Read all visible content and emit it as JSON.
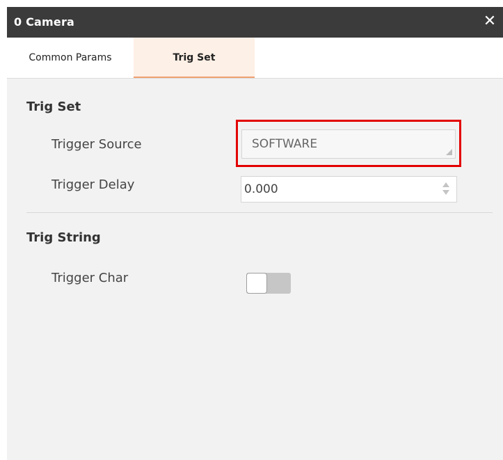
{
  "window": {
    "title": "0 Camera",
    "close_icon": "close-icon",
    "close_glyph": "✕"
  },
  "tabs": [
    {
      "label": "Common Params",
      "active": false
    },
    {
      "label": "Trig Set",
      "active": true
    }
  ],
  "sections": {
    "trig_set": {
      "title": "Trig Set",
      "trigger_source": {
        "label": "Trigger Source",
        "value": "SOFTWARE"
      },
      "trigger_delay": {
        "label": "Trigger Delay",
        "value": "0.000"
      }
    },
    "trig_string": {
      "title": "Trig String",
      "trigger_char": {
        "label": "Trigger Char",
        "enabled": false
      }
    }
  },
  "colors": {
    "titlebar": "#3b3b3b",
    "active_tab": "#fdf0e6",
    "highlight": "#e30000"
  }
}
